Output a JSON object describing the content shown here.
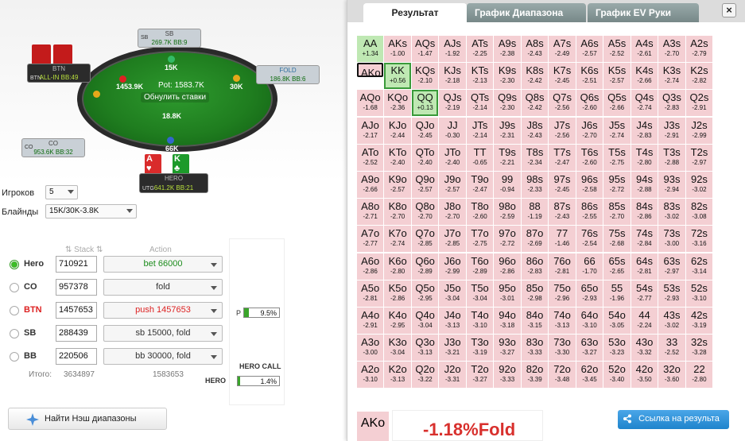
{
  "table": {
    "pot": "Pot: 1583.7K",
    "reset_label": "Обнулить ставки",
    "seats": [
      {
        "pos": "BTN",
        "name": "BTN",
        "stack": "ALL-IN BB:49",
        "bet": "1453.9K"
      },
      {
        "pos": "SB",
        "name": "SB",
        "stack": "269.7K BB:9",
        "bet": "15K"
      },
      {
        "pos": "",
        "name": "FOLD",
        "stack": "186.8K BB:6",
        "bet": "30K"
      },
      {
        "pos": "CO",
        "name": "CO",
        "stack": "953.6K BB:32",
        "bet": ""
      },
      {
        "pos": "UTG",
        "name": "HERO",
        "stack": "641.2K BB:21",
        "bet": "66K"
      }
    ],
    "center_bet": "18.8K",
    "hero_cards": [
      {
        "rank": "A",
        "suit": "♥"
      },
      {
        "rank": "K",
        "suit": "♣"
      }
    ],
    "hero_pos": "UTG"
  },
  "controls": {
    "players_label": "Игроков",
    "players_value": "5",
    "blinds_label": "Блайнды",
    "blinds_value": "15K/30K-3.8K"
  },
  "headers": {
    "stack": "Stack",
    "action": "Action"
  },
  "players": [
    {
      "name": "Hero",
      "stack": "710921",
      "action": "bet 66000",
      "color": "#1c8c1c",
      "selected": true
    },
    {
      "name": "CO",
      "stack": "957378",
      "action": "fold",
      "color": "#333",
      "selected": false
    },
    {
      "name": "BTN",
      "stack": "1457653",
      "action": "push 1457653",
      "color": "#d22",
      "selected": false,
      "name_color": "#d22"
    },
    {
      "name": "SB",
      "stack": "288439",
      "action": "sb 15000, fold",
      "color": "#333",
      "selected": false
    },
    {
      "name": "BB",
      "stack": "220506",
      "action": "bb 30000, fold",
      "color": "#333",
      "selected": false
    }
  ],
  "totals": {
    "label": "Итого:",
    "stacks": "3634897",
    "bets": "1583653"
  },
  "equity": {
    "p_label": "P",
    "p_value": "9.5%",
    "p_fraction": 0.095,
    "hero_call_label": "HERO CALL",
    "hero_label": "HERO",
    "hero_call_value": "1.4%",
    "hero_fraction": 0.014
  },
  "nash_button": "Найти Нэш диапазоны",
  "tabs": [
    "Результат",
    "График Диапазона",
    "График EV Руки"
  ],
  "close_label": "×",
  "grid": [
    [
      [
        "AA",
        "+1.34"
      ],
      [
        "AKs",
        "-1.00"
      ],
      [
        "AQs",
        "-1.47"
      ],
      [
        "AJs",
        "-1.92"
      ],
      [
        "ATs",
        "-2.25"
      ],
      [
        "A9s",
        "-2.38"
      ],
      [
        "A8s",
        "-2.43"
      ],
      [
        "A7s",
        "-2.49"
      ],
      [
        "A6s",
        "-2.57"
      ],
      [
        "A5s",
        "-2.52"
      ],
      [
        "A4s",
        "-2.61"
      ],
      [
        "A3s",
        "-2.70"
      ],
      [
        "A2s",
        "-2.79"
      ]
    ],
    [
      [
        "AKo",
        "-1.18"
      ],
      [
        "KK",
        "+0.56"
      ],
      [
        "KQs",
        "-2.10"
      ],
      [
        "KJs",
        "-2.18"
      ],
      [
        "KTs",
        "-2.13"
      ],
      [
        "K9s",
        "-2.30"
      ],
      [
        "K8s",
        "-2.42"
      ],
      [
        "K7s",
        "-2.45"
      ],
      [
        "K6s",
        "-2.51"
      ],
      [
        "K5s",
        "-2.57"
      ],
      [
        "K4s",
        "-2.66"
      ],
      [
        "K3s",
        "-2.74"
      ],
      [
        "K2s",
        "-2.82"
      ]
    ],
    [
      [
        "AQo",
        "-1.68"
      ],
      [
        "KQo",
        "-2.36"
      ],
      [
        "QQ",
        "+0.13"
      ],
      [
        "QJs",
        "-2.19"
      ],
      [
        "QTs",
        "-2.14"
      ],
      [
        "Q9s",
        "-2.30"
      ],
      [
        "Q8s",
        "-2.42"
      ],
      [
        "Q7s",
        "-2.56"
      ],
      [
        "Q6s",
        "-2.60"
      ],
      [
        "Q5s",
        "-2.66"
      ],
      [
        "Q4s",
        "-2.74"
      ],
      [
        "Q3s",
        "-2.83"
      ],
      [
        "Q2s",
        "-2.91"
      ]
    ],
    [
      [
        "AJo",
        "-2.17"
      ],
      [
        "KJo",
        "-2.44"
      ],
      [
        "QJo",
        "-2.45"
      ],
      [
        "JJ",
        "-0.30"
      ],
      [
        "JTs",
        "-2.14"
      ],
      [
        "J9s",
        "-2.31"
      ],
      [
        "J8s",
        "-2.43"
      ],
      [
        "J7s",
        "-2.56"
      ],
      [
        "J6s",
        "-2.70"
      ],
      [
        "J5s",
        "-2.74"
      ],
      [
        "J4s",
        "-2.83"
      ],
      [
        "J3s",
        "-2.91"
      ],
      [
        "J2s",
        "-2.99"
      ]
    ],
    [
      [
        "ATo",
        "-2.52"
      ],
      [
        "KTo",
        "-2.40"
      ],
      [
        "QTo",
        "-2.40"
      ],
      [
        "JTo",
        "-2.40"
      ],
      [
        "TT",
        "-0.65"
      ],
      [
        "T9s",
        "-2.21"
      ],
      [
        "T8s",
        "-2.34"
      ],
      [
        "T7s",
        "-2.47"
      ],
      [
        "T6s",
        "-2.60"
      ],
      [
        "T5s",
        "-2.75"
      ],
      [
        "T4s",
        "-2.80"
      ],
      [
        "T3s",
        "-2.88"
      ],
      [
        "T2s",
        "-2.97"
      ]
    ],
    [
      [
        "A9o",
        "-2.66"
      ],
      [
        "K9o",
        "-2.57"
      ],
      [
        "Q9o",
        "-2.57"
      ],
      [
        "J9o",
        "-2.57"
      ],
      [
        "T9o",
        "-2.47"
      ],
      [
        "99",
        "-0.94"
      ],
      [
        "98s",
        "-2.33"
      ],
      [
        "97s",
        "-2.45"
      ],
      [
        "96s",
        "-2.58"
      ],
      [
        "95s",
        "-2.72"
      ],
      [
        "94s",
        "-2.88"
      ],
      [
        "93s",
        "-2.94"
      ],
      [
        "92s",
        "-3.02"
      ]
    ],
    [
      [
        "A8o",
        "-2.71"
      ],
      [
        "K8o",
        "-2.70"
      ],
      [
        "Q8o",
        "-2.70"
      ],
      [
        "J8o",
        "-2.70"
      ],
      [
        "T8o",
        "-2.60"
      ],
      [
        "98o",
        "-2.59"
      ],
      [
        "88",
        "-1.19"
      ],
      [
        "87s",
        "-2.43"
      ],
      [
        "86s",
        "-2.55"
      ],
      [
        "85s",
        "-2.70"
      ],
      [
        "84s",
        "-2.86"
      ],
      [
        "83s",
        "-3.02"
      ],
      [
        "82s",
        "-3.08"
      ]
    ],
    [
      [
        "A7o",
        "-2.77"
      ],
      [
        "K7o",
        "-2.74"
      ],
      [
        "Q7o",
        "-2.85"
      ],
      [
        "J7o",
        "-2.85"
      ],
      [
        "T7o",
        "-2.75"
      ],
      [
        "97o",
        "-2.72"
      ],
      [
        "87o",
        "-2.69"
      ],
      [
        "77",
        "-1.46"
      ],
      [
        "76s",
        "-2.54"
      ],
      [
        "75s",
        "-2.68"
      ],
      [
        "74s",
        "-2.84"
      ],
      [
        "73s",
        "-3.00"
      ],
      [
        "72s",
        "-3.16"
      ]
    ],
    [
      [
        "A6o",
        "-2.86"
      ],
      [
        "K6o",
        "-2.80"
      ],
      [
        "Q6o",
        "-2.89"
      ],
      [
        "J6o",
        "-2.99"
      ],
      [
        "T6o",
        "-2.89"
      ],
      [
        "96o",
        "-2.86"
      ],
      [
        "86o",
        "-2.83"
      ],
      [
        "76o",
        "-2.81"
      ],
      [
        "66",
        "-1.70"
      ],
      [
        "65s",
        "-2.65"
      ],
      [
        "64s",
        "-2.81"
      ],
      [
        "63s",
        "-2.97"
      ],
      [
        "62s",
        "-3.14"
      ]
    ],
    [
      [
        "A5o",
        "-2.81"
      ],
      [
        "K5o",
        "-2.86"
      ],
      [
        "Q5o",
        "-2.95"
      ],
      [
        "J5o",
        "-3.04"
      ],
      [
        "T5o",
        "-3.04"
      ],
      [
        "95o",
        "-3.01"
      ],
      [
        "85o",
        "-2.98"
      ],
      [
        "75o",
        "-2.96"
      ],
      [
        "65o",
        "-2.93"
      ],
      [
        "55",
        "-1.96"
      ],
      [
        "54s",
        "-2.77"
      ],
      [
        "53s",
        "-2.93"
      ],
      [
        "52s",
        "-3.10"
      ]
    ],
    [
      [
        "A4o",
        "-2.91"
      ],
      [
        "K4o",
        "-2.95"
      ],
      [
        "Q4o",
        "-3.04"
      ],
      [
        "J4o",
        "-3.13"
      ],
      [
        "T4o",
        "-3.10"
      ],
      [
        "94o",
        "-3.18"
      ],
      [
        "84o",
        "-3.15"
      ],
      [
        "74o",
        "-3.13"
      ],
      [
        "64o",
        "-3.10"
      ],
      [
        "54o",
        "-3.05"
      ],
      [
        "44",
        "-2.24"
      ],
      [
        "43s",
        "-3.02"
      ],
      [
        "42s",
        "-3.19"
      ]
    ],
    [
      [
        "A3o",
        "-3.00"
      ],
      [
        "K3o",
        "-3.04"
      ],
      [
        "Q3o",
        "-3.13"
      ],
      [
        "J3o",
        "-3.21"
      ],
      [
        "T3o",
        "-3.19"
      ],
      [
        "93o",
        "-3.27"
      ],
      [
        "83o",
        "-3.33"
      ],
      [
        "73o",
        "-3.30"
      ],
      [
        "63o",
        "-3.27"
      ],
      [
        "53o",
        "-3.23"
      ],
      [
        "43o",
        "-3.32"
      ],
      [
        "33",
        "-2.52"
      ],
      [
        "32s",
        "-3.28"
      ]
    ],
    [
      [
        "A2o",
        "-3.10"
      ],
      [
        "K2o",
        "-3.13"
      ],
      [
        "Q2o",
        "-3.22"
      ],
      [
        "J2o",
        "-3.31"
      ],
      [
        "T2o",
        "-3.27"
      ],
      [
        "92o",
        "-3.33"
      ],
      [
        "82o",
        "-3.39"
      ],
      [
        "72o",
        "-3.48"
      ],
      [
        "62o",
        "-3.45"
      ],
      [
        "52o",
        "-3.40"
      ],
      [
        "42o",
        "-3.50"
      ],
      [
        "32o",
        "-3.60"
      ],
      [
        "22",
        "-2.80"
      ]
    ]
  ],
  "selected_hand": "AKo",
  "selected_hand_ev": "-1.18",
  "result_text": "-1.18%Fold",
  "link_button": "Ссылка на результа",
  "colors": {
    "positive": "#bfe8b3",
    "negative": "#f4cfd3",
    "fold_text": "#d8302d",
    "accent": "#1f84cc"
  }
}
